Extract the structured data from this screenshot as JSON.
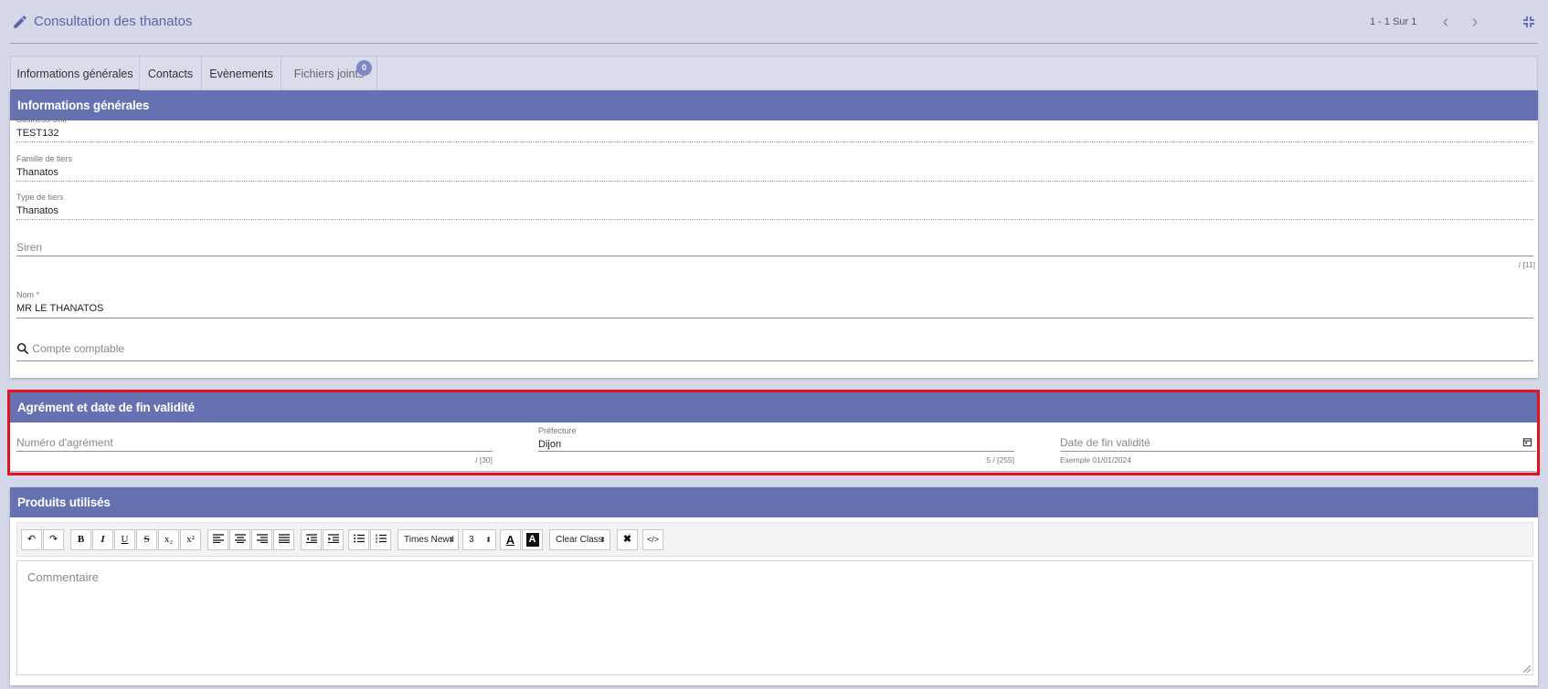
{
  "topbar": {
    "title": "Consultation des thanatos",
    "pager": "1 - 1 Sur 1",
    "prev_glyph": "‹",
    "next_glyph": "›"
  },
  "tabs": [
    {
      "label": "Informations générales",
      "active": true
    },
    {
      "label": "Contacts"
    },
    {
      "label": "Evènements"
    },
    {
      "label": "Fichiers joints",
      "badge": "0"
    }
  ],
  "general": {
    "header": "Informations générales",
    "business_unit": {
      "label": "Business Unit",
      "value": "TEST132"
    },
    "famille": {
      "label": "Famille de tiers",
      "value": "Thanatos"
    },
    "type": {
      "label": "Type de tiers",
      "value": "Thanatos"
    },
    "siren": {
      "placeholder": "Siren",
      "counter": "/ [11]"
    },
    "nom": {
      "label": "Nom *",
      "value": "MR LE THANATOS"
    },
    "compte": {
      "placeholder": "Compte comptable"
    }
  },
  "agrement": {
    "header": "Agrément et date de fin validité",
    "numero": {
      "placeholder": "Numéro d'agrément",
      "counter": "/ [30]"
    },
    "prefecture": {
      "label": "Préfecture",
      "value": "Dijon",
      "counter": "5 / [255]"
    },
    "date_fin": {
      "placeholder": "Date de fin validité",
      "hint": "Exemple 01/01/2024"
    }
  },
  "produits": {
    "header": "Produits utilisés",
    "toolbar": {
      "undo": "↶",
      "redo": "↷",
      "bold": "B",
      "italic": "I",
      "underline": "U",
      "strike": "S",
      "sub": "x₂",
      "sup": "x²",
      "font": "Times New I",
      "size": "3",
      "font_color": "A",
      "bg_color": "A",
      "clear_class": "Clear Class",
      "remove_format": "✖",
      "code": "</>"
    },
    "editor_placeholder": "Commentaire"
  },
  "colors": {
    "accent": "#6571b0",
    "highlight": "#e0141e",
    "background": "#d4d8e8"
  }
}
